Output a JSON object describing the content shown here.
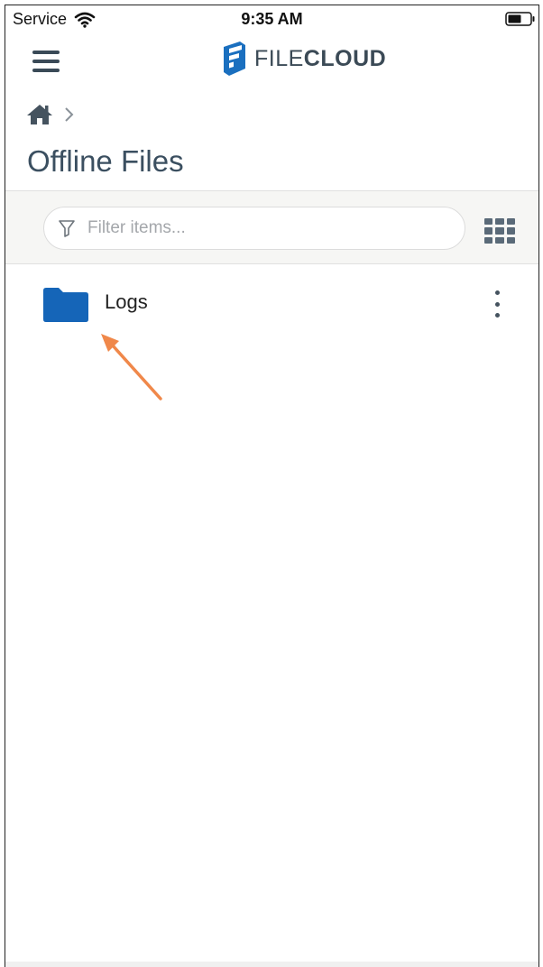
{
  "status_bar": {
    "carrier": "Service",
    "time": "9:35 AM"
  },
  "app": {
    "logo_prefix": "FILE",
    "logo_suffix": "CLOUD"
  },
  "page": {
    "title": "Offline Files"
  },
  "filter": {
    "placeholder": "Filter items..."
  },
  "items": [
    {
      "name": "Logs",
      "type": "folder",
      "icon": "folder-icon"
    }
  ],
  "colors": {
    "accent": "#1565b8",
    "title": "#3b4f60",
    "arrow": "#f0884a",
    "toolbar_bg": "#f6f6f4"
  }
}
